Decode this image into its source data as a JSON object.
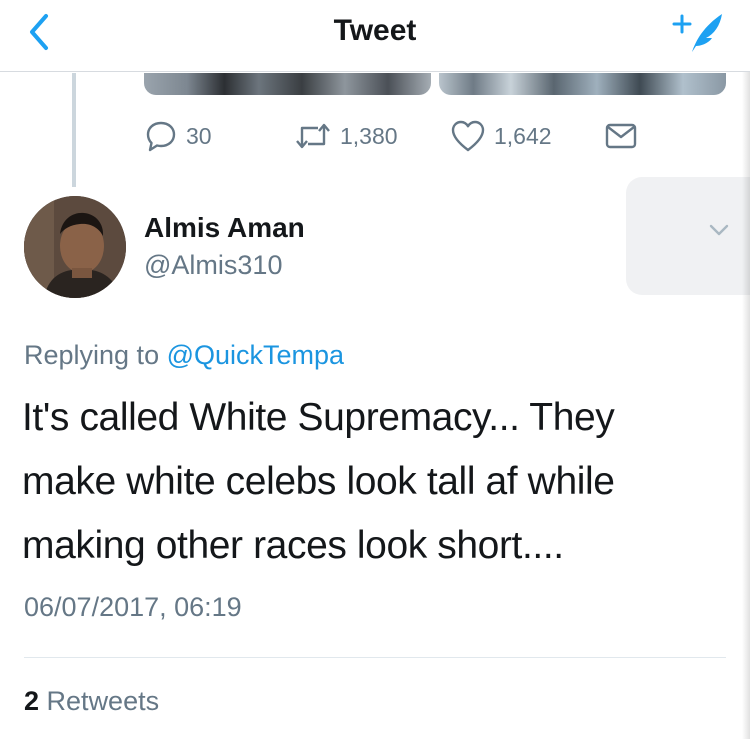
{
  "nav": {
    "title": "Tweet",
    "back_icon": "chevron-left-icon",
    "compose_icon": "compose-tweet-icon",
    "accent_color": "#1da1f2"
  },
  "parent_tweet": {
    "actions": {
      "replies": "30",
      "retweets": "1,380",
      "likes": "1,642"
    }
  },
  "tweet": {
    "author_name": "Almis Aman",
    "author_handle": "@Almis310",
    "replying_prefix": "Replying to",
    "replying_to": "@QuickTempa",
    "text": "It's called White Supremacy... They make white celebs look tall af while making other races look short....",
    "timestamp": "06/07/2017, 06:19",
    "retweet_count": "2",
    "retweet_label": "Retweets"
  }
}
